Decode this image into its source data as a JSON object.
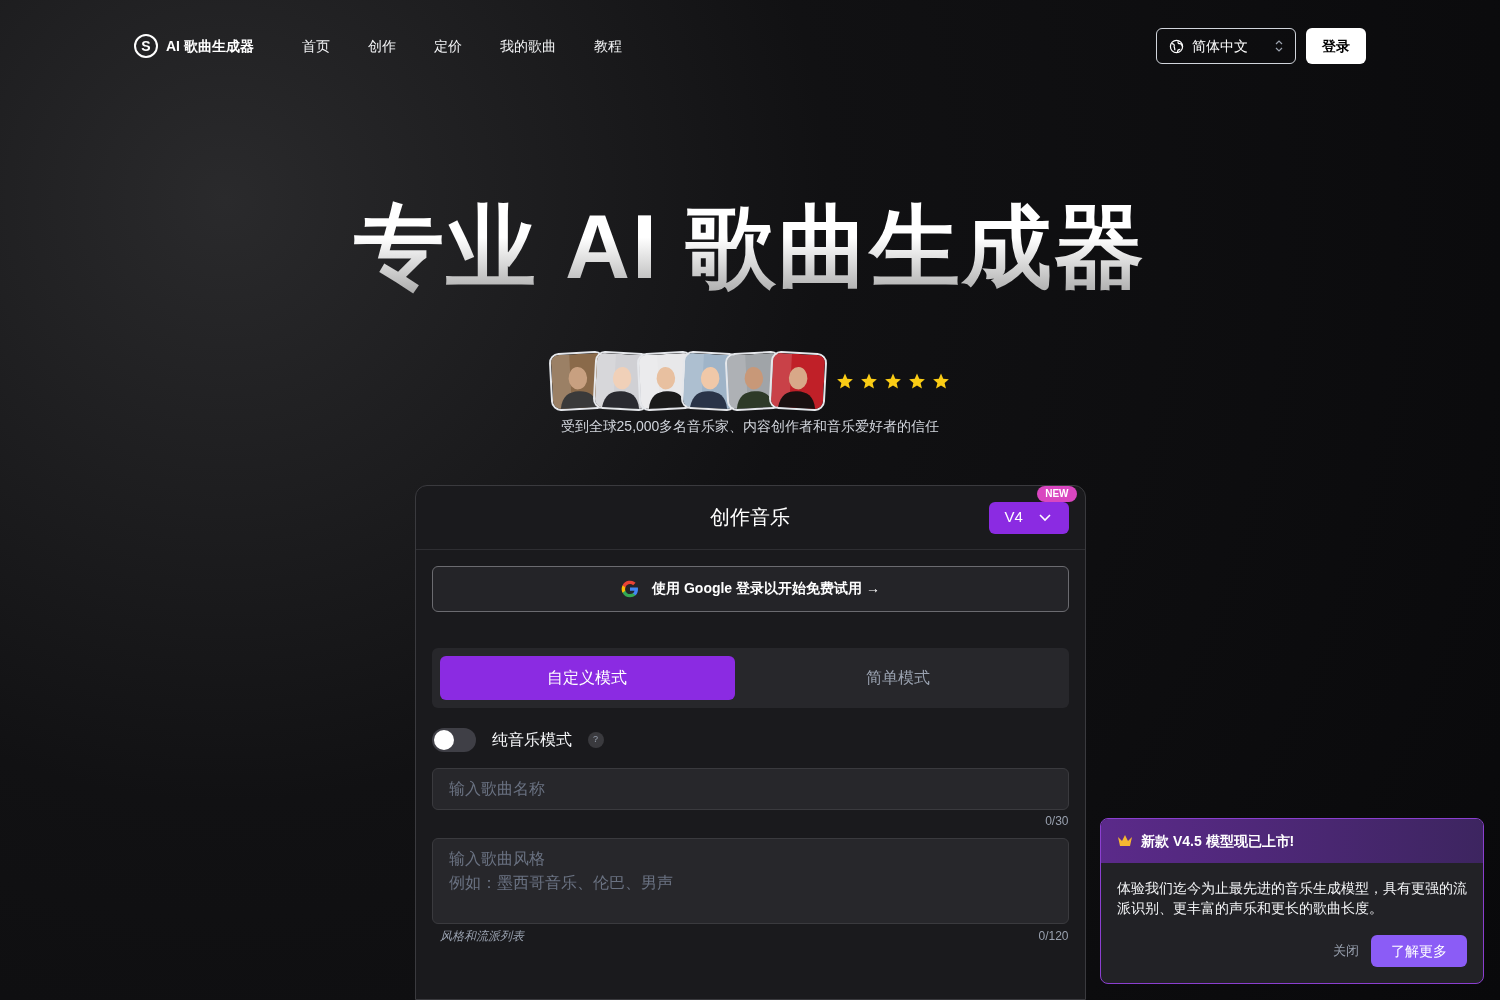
{
  "nav": {
    "logo_letter": "S",
    "brand": "AI 歌曲生成器",
    "links": [
      "首页",
      "创作",
      "定价",
      "我的歌曲",
      "教程"
    ],
    "language": "简体中文",
    "login": "登录"
  },
  "hero": {
    "title": "专业 AI 歌曲生成器",
    "avatars": [
      {
        "kind": "picture"
      },
      {
        "kind": "picture"
      },
      {
        "kind": "picture"
      },
      {
        "kind": "picture"
      },
      {
        "kind": "picture"
      },
      {
        "kind": "picture"
      }
    ],
    "stars": 5,
    "caption": "受到全球25,000多名音乐家、内容创作者和音乐爱好者的信任"
  },
  "card": {
    "title": "创作音乐",
    "model": "V4",
    "model_badge": "NEW",
    "google_button": "使用 Google 登录以开始免费试用 →",
    "modes": [
      {
        "label": "自定义模式",
        "selected": true
      },
      {
        "label": "简单模式",
        "selected": false
      }
    ],
    "instrumental": {
      "label": "纯音乐模式",
      "on": false,
      "help": "?"
    },
    "song_name": {
      "placeholder": "输入歌曲名称",
      "count": "0/30"
    },
    "style": {
      "placeholder": "输入歌曲风格",
      "example": "例如：墨西哥音乐、伦巴、男声",
      "label": "风格和流派列表",
      "count": "0/120"
    }
  },
  "popup": {
    "title": "新款 V4.5 模型现已上市!",
    "body": "体验我们迄今为止最先进的音乐生成模型，具有更强的流派识别、更丰富的声乐和更长的歌曲长度。",
    "close": "关闭",
    "learn_more": "了解更多"
  }
}
